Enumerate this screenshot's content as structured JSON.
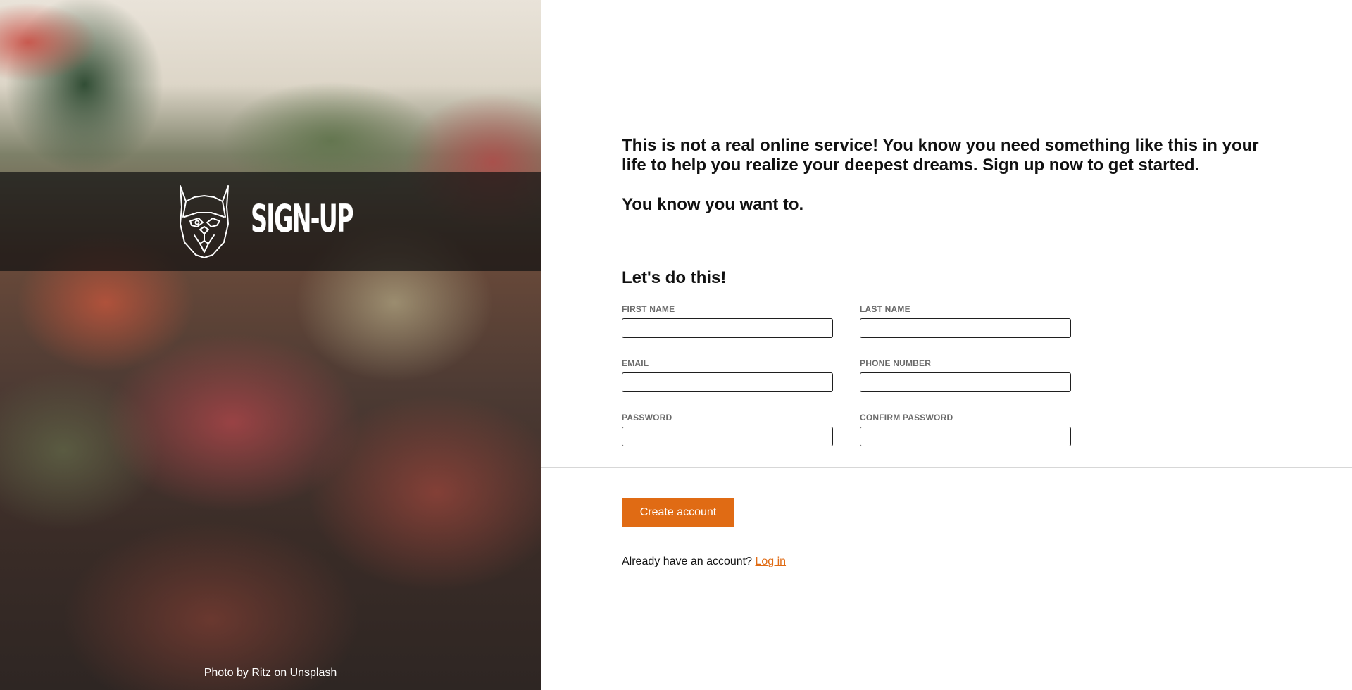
{
  "hero": {
    "title": "SIGN-UP",
    "photo_credit": "Photo by Ritz on Unsplash",
    "logo_icon": "bulldog-head-icon"
  },
  "intro": {
    "paragraph_1": "This is not a real online service! You know you need something like this in your life to help you realize your deepest dreams. Sign up now to get started.",
    "paragraph_2": "You know you want to."
  },
  "form": {
    "heading": "Let's do this!",
    "fields": {
      "first_name": {
        "label": "FIRST NAME",
        "value": ""
      },
      "last_name": {
        "label": "LAST NAME",
        "value": ""
      },
      "email": {
        "label": "EMAIL",
        "value": ""
      },
      "phone": {
        "label": "PHONE NUMBER",
        "value": ""
      },
      "password": {
        "label": "PASSWORD",
        "value": ""
      },
      "confirm_password": {
        "label": "CONFIRM PASSWORD",
        "value": ""
      }
    },
    "submit_label": "Create account",
    "login_prompt": "Already have an account?",
    "login_link": "Log in"
  },
  "colors": {
    "accent": "#e06b14",
    "label_gray": "#6b6b6b",
    "divider": "#d7d7d7"
  }
}
